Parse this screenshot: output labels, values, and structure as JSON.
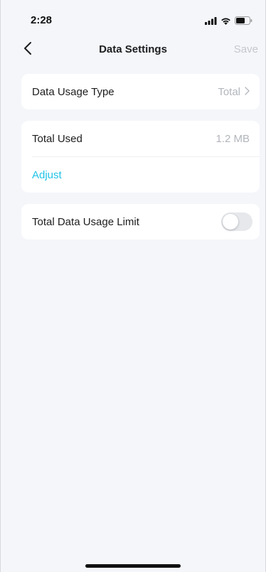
{
  "status_bar": {
    "time": "2:28",
    "icons": [
      "signal-icon",
      "wifi-icon",
      "battery-icon"
    ]
  },
  "nav": {
    "title": "Data Settings",
    "save_label": "Save",
    "back_icon": "chevron-left-icon"
  },
  "usage_type": {
    "label": "Data Usage Type",
    "value": "Total"
  },
  "total_used": {
    "label": "Total Used",
    "value": "1.2 MB",
    "adjust_label": "Adjust"
  },
  "limit": {
    "label": "Total Data Usage Limit",
    "enabled": false
  },
  "colors": {
    "accent": "#22c3e6",
    "background": "#f4f6fa",
    "muted_text": "#b2b6bc"
  }
}
